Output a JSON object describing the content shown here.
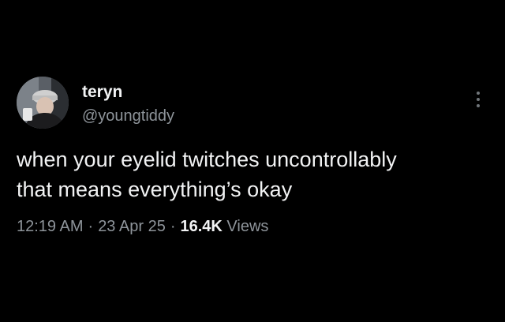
{
  "author": {
    "display_name": "teryn",
    "handle": "@youngtiddy",
    "avatar_icon": "profile-photo"
  },
  "more_menu_icon": "more-vertical-icon",
  "tweet": {
    "lines": [
      "when your eyelid twitches uncontrollably",
      "that means everything’s okay"
    ]
  },
  "meta": {
    "time": "12:19 AM",
    "separator": "·",
    "date": "23 Apr 25",
    "views_count": "16.4K",
    "views_label": "Views"
  },
  "colors": {
    "background": "#000000",
    "primary_text": "#f2f3f4",
    "secondary_text": "#8e949a"
  }
}
